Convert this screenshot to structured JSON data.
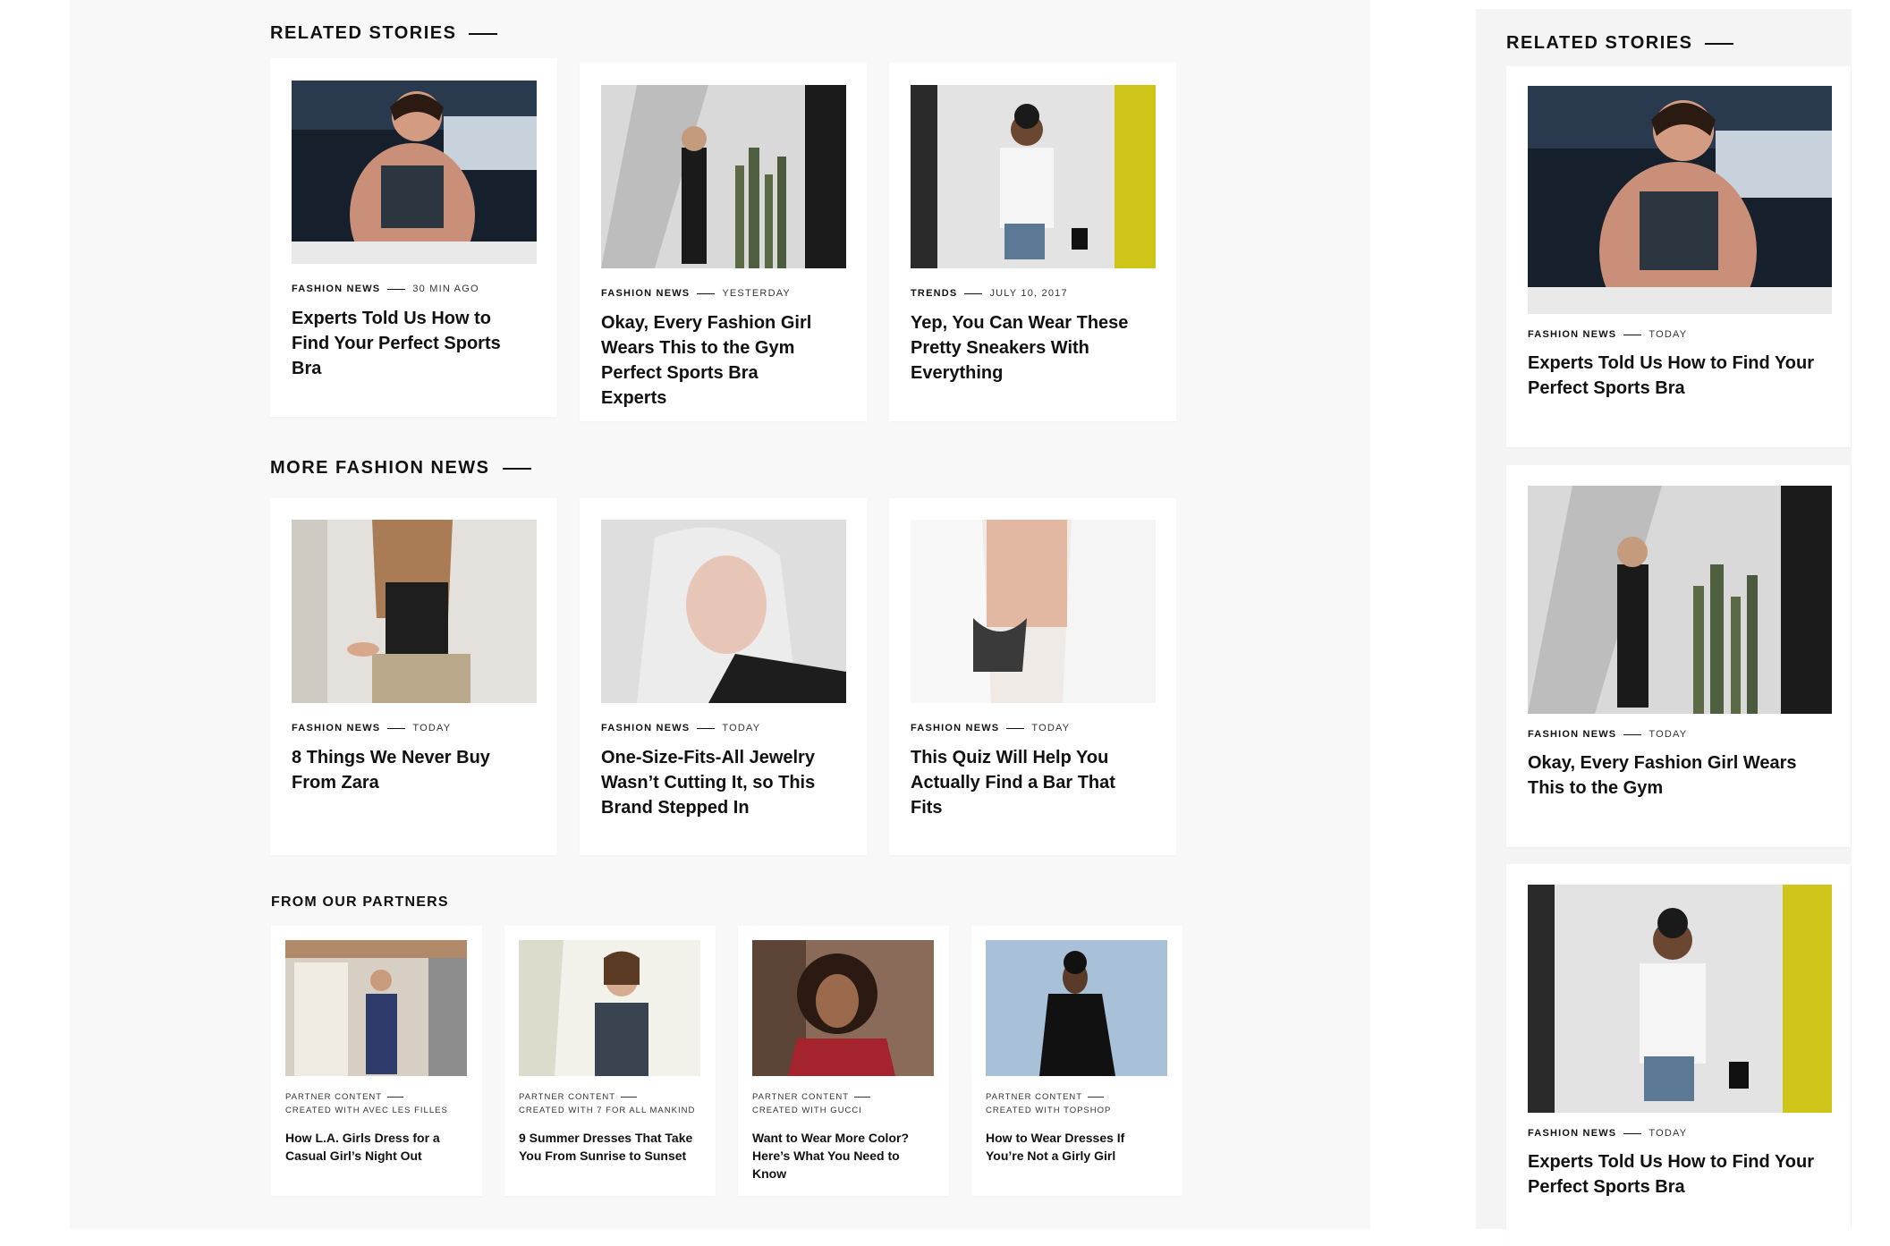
{
  "related_stories": {
    "heading": "RELATED STORIES",
    "cards": [
      {
        "category": "FASHION NEWS",
        "time": "30 MIN AGO",
        "title": "Experts Told Us How to Find Your Perfect Sports Bra",
        "image": "sports-bra-photo"
      },
      {
        "category": "FASHION NEWS",
        "time": "YESTERDAY",
        "title": "Okay, Every Fashion Girl Wears This to the Gym Perfect Sports Bra Experts",
        "image": "cactus-wall-photo"
      },
      {
        "category": "TRENDS",
        "time": "JULY 10, 2017",
        "title": "Yep, You Can Wear These Pretty Sneakers With Everything",
        "image": "yellow-wall-photo"
      }
    ]
  },
  "more_fashion_news": {
    "heading": "MORE FASHION NEWS",
    "cards": [
      {
        "category": "FASHION NEWS",
        "time": "TODAY",
        "title": "8 Things We Never Buy From Zara",
        "image": "phone-girl-photo"
      },
      {
        "category": "FASHION NEWS",
        "time": "TODAY",
        "title": "One-Size-Fits-All Jewelry Wasn’t Cutting It, so This Brand Stepped In",
        "image": "blonde-portrait-photo"
      },
      {
        "category": "FASHION NEWS",
        "time": "TODAY",
        "title": "This Quiz Will Help You Actually Find a Bar That Fits",
        "image": "lace-bralette-photo"
      }
    ]
  },
  "partners": {
    "heading": "FROM OUR PARTNERS",
    "cards": [
      {
        "label": "PARTNER CONTENT",
        "created": "CREATED WITH AVEC LES FILLES",
        "title": "How L.A. Girls Dress for a Casual Girl’s Night Out",
        "image": "la-street-photo"
      },
      {
        "label": "PARTNER CONTENT",
        "created": "CREATED WITH 7 FOR ALL MANKIND",
        "title": "9 Summer Dresses That Take You From Sunrise to Sunset",
        "image": "summer-dress-photo"
      },
      {
        "label": "PARTNER CONTENT",
        "created": "CREATED WITH GUCCI",
        "title": "Want to Wear More Color? Here’s What You Need to Know",
        "image": "curly-hair-photo"
      },
      {
        "label": "PARTNER CONTENT",
        "created": "CREATED WITH TOPSHOP",
        "title": "How to Wear Dresses If You’re Not a Girly Girl",
        "image": "black-jacket-photo"
      }
    ]
  },
  "sidebar": {
    "heading": "RELATED STORIES",
    "cards": [
      {
        "category": "FASHION NEWS",
        "time": "TODAY",
        "title": "Experts Told Us How to Find Your Perfect Sports Bra",
        "image": "sports-bra-photo"
      },
      {
        "category": "FASHION NEWS",
        "time": "TODAY",
        "title": "Okay, Every Fashion Girl Wears This to the Gym",
        "image": "cactus-wall-photo"
      },
      {
        "category": "FASHION NEWS",
        "time": "TODAY",
        "title": "Experts Told Us How to Find Your Perfect Sports Bra",
        "image": "yellow-wall-photo"
      }
    ]
  },
  "colors": {
    "panel_bg": "#f8f8f8",
    "card_bg": "#ffffff",
    "text": "#111111",
    "accent_yellow": "#d9cc16"
  }
}
